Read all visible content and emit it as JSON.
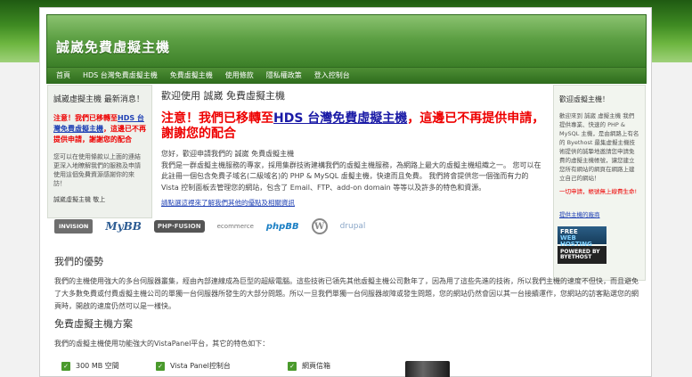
{
  "header": {
    "title": "誠崴免費虛擬主機"
  },
  "nav": [
    "首頁",
    "HDS 台灣免費虛擬主機",
    "免費虛擬主機",
    "使用條款",
    "隱私權政策",
    "登入控制台"
  ],
  "left": {
    "heading": "誠崴虛擬主機 最新消息！",
    "notice_prefix": "注意！我們已移轉至",
    "notice_link": "HDS 台灣免費虛擬主機",
    "notice_suffix": "，這邊已不再提供申請，謝謝您的配合",
    "desc": "您可以在使用條款以上面的連結更深入地瞭解我們的服務及申請使用這個免費資源感謝你的來訪！",
    "sign": "誠崴虛擬主機 敬上"
  },
  "center": {
    "welcome": "歡迎使用 誠崴 免費虛擬主機",
    "notice_prefix": "注意！我們已移轉至",
    "notice_link": "HDS 台灣免費虛擬主機",
    "notice_suffix": "，這邊已不再提供申請，謝謝您的配合",
    "para": "您好，歡迎申請我們的 誠崴 免費虛擬主機\n我們是一群虛擬主機服務的專家，採用集群技術建構我們的虛擬主機服務，為網路上最大的虛擬主機組織之一。 您可以在此註冊一個包含免費子域名(二級域名)的 PHP & MySQL 虛擬主機，快速而且免費。 我們將會提供您一個強而有力的 Vista 控制面板去管理您的網站，包含了 Email、FTP、add-on domain 等等以及許多的特色和資源。",
    "more_link": "請點選這裡來了解我們其他的優點及相關資訊"
  },
  "right": {
    "heading": "歡迎虛擬主機！",
    "text": "歡迎來到 誠崴 虛擬主機 我們提供專業、快速的 PHP & MySQL 主機，是由網路上有名的 Byethost 最集虛擬主機技術提供的誠摯地邀請您申請免費的虛擬主機帳號，讓您建立您所有網站的網頁在網路上建立自己的網站！",
    "red": "一切申請，帳號無上線費生命!",
    "link": "提供主機的廠商",
    "badge_line1a": "FREE",
    "badge_line1b": "WEB HOSTING",
    "badge_line2a": "POWERED BY",
    "badge_line2b": "BYETHOST"
  },
  "logos": [
    "INVISION",
    "MyBB",
    "PHP·FUSION",
    "ecommerce",
    "phpBB",
    "W",
    "drupal"
  ],
  "advantages": {
    "title": "我們的優勢",
    "text": "我們的主機使用強大的多台伺服器叢集，經由內部連線成為巨型的超級電腦。這些技術已領先其他虛擬主機公司數年了，因為用了這些先進的技術，所以我們主機的速度不但快，而且避免了大多數免費或付費虛擬主機公司的單獨一台伺服器所發生的大部分問題。所以一旦我們單獨一台伺服器故障或發生問題，您的網站仍然會因以其一台接續運作，您網站的訪客點選您的網頁時，開啟的速度仍然可以是一樣快。"
  },
  "plans": {
    "title": "免費虛擬主機方案",
    "text": "我們的虛擬主機使用功能強大的VistaPanel平台，其它的特色如下：",
    "features": [
      "300 MB 空間",
      "Vista Panel控制台",
      "網頁信箱"
    ]
  }
}
